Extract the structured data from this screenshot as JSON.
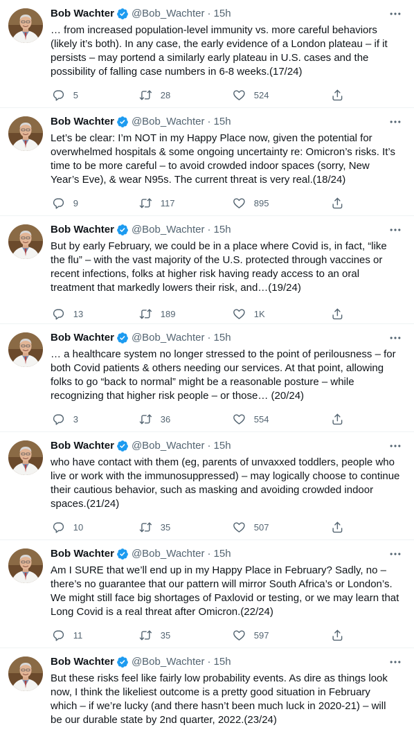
{
  "colors": {
    "text": "#0f1419",
    "secondary": "#536471",
    "verified": "#1d9bf0",
    "divider": "#eff3f4"
  },
  "icons": {
    "reply": "reply-icon",
    "retweet": "retweet-icon",
    "like": "heart-icon",
    "share": "share-icon",
    "more": "more-icon",
    "verified": "verified-badge-icon"
  },
  "tweets": [
    {
      "name": "Bob Wachter",
      "handle": "@Bob_Wachter",
      "sep": "·",
      "time": "15h",
      "text": "… from increased population-level immunity vs. more careful behaviors\n(likely it’s both). In any case, the early evidence of a London plateau – if it\npersists – may portend a similarly early plateau in U.S. cases and the\npossibility of falling case numbers in 6-8 weeks.(17/24)",
      "replies": "5",
      "retweets": "28",
      "likes": "524"
    },
    {
      "name": "Bob Wachter",
      "handle": "@Bob_Wachter",
      "sep": "·",
      "time": "15h",
      "text": "Let’s be clear: I’m NOT in my Happy Place now, given the potential for\noverwhelmed hospitals & some ongoing uncertainty re: Omicron’s risks. It’s\ntime to be more careful – to avoid crowded indoor spaces (sorry, New\nYear’s Eve), & wear N95s. The current threat is very real.(18/24)",
      "replies": "9",
      "retweets": "117",
      "likes": "895"
    },
    {
      "name": "Bob Wachter",
      "handle": "@Bob_Wachter",
      "sep": "·",
      "time": "15h",
      "text": "But by early February, we could be in a place where Covid is, in fact, “like\nthe flu” – with the vast majority of the U.S. protected through vaccines or\nrecent infections, folks at higher risk having ready access to an oral\ntreatment that markedly lowers their risk, and…(19/24)",
      "replies": "13",
      "retweets": "189",
      "likes": "1K"
    },
    {
      "name": "Bob Wachter",
      "handle": "@Bob_Wachter",
      "sep": "·",
      "time": "15h",
      "text": "… a healthcare system no longer stressed to the point of perilousness – for\nboth Covid patients & others needing our services. At that point, allowing\nfolks to go “back to normal” might be a reasonable posture – while\nrecognizing that higher risk people – or those… (20/24)",
      "replies": "3",
      "retweets": "36",
      "likes": "554"
    },
    {
      "name": "Bob Wachter",
      "handle": "@Bob_Wachter",
      "sep": "·",
      "time": "15h",
      "text": "who have contact with them (eg, parents of unvaxxed toddlers, people who\nlive or work with the immunosuppressed) – may logically choose to continue\ntheir cautious behavior, such as masking and avoiding crowded indoor\nspaces.(21/24)",
      "replies": "10",
      "retweets": "35",
      "likes": "507"
    },
    {
      "name": "Bob Wachter",
      "handle": "@Bob_Wachter",
      "sep": "·",
      "time": "15h",
      "text": "Am I SURE that we’ll end up in my Happy Place in February? Sadly, no –\nthere’s no guarantee that our pattern will mirror South Africa’s or London’s.\nWe might still face big shortages of Paxlovid or testing, or we may learn that\nLong Covid is a real threat after Omicron.(22/24)",
      "replies": "11",
      "retweets": "35",
      "likes": "597"
    },
    {
      "name": "Bob Wachter",
      "handle": "@Bob_Wachter",
      "sep": "·",
      "time": "15h",
      "text": "But these risks feel like fairly low probability events. As dire as things look\nnow, I think the likeliest outcome is a pretty good situation in February\nwhich – if we’re lucky (and there hasn’t been much luck in 2020-21) – will\nbe our durable state by 2nd quarter, 2022.(23/24)",
      "replies": null,
      "retweets": null,
      "likes": null
    }
  ]
}
